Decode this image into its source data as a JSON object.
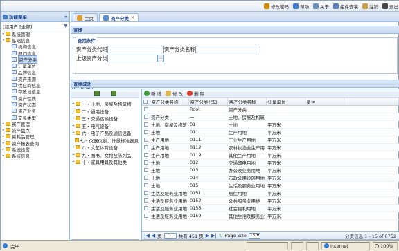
{
  "topbar": {
    "buttons": [
      {
        "label": "修改密码",
        "color": "#d48a00"
      },
      {
        "label": "帮助",
        "color": "#3a7bd5"
      },
      {
        "label": "关于",
        "color": "#6a8bb8"
      },
      {
        "label": "组件安装",
        "color": "#5a7ec0"
      },
      {
        "label": "注销",
        "color": "#c8a040"
      },
      {
        "label": "退出",
        "color": "#444444"
      }
    ]
  },
  "sidebar": {
    "title": "功能菜单",
    "collapse": "«",
    "user": "[超用户 [全部]",
    "tree": [
      {
        "label": "系统管理",
        "type": "folder",
        "toggle": "+",
        "indent": 0
      },
      {
        "label": "基础信息",
        "type": "folder",
        "toggle": "-",
        "indent": 0
      },
      {
        "label": "机构信息",
        "type": "leaf",
        "indent": 1
      },
      {
        "label": "部门信息",
        "type": "leaf",
        "indent": 1
      },
      {
        "label": "资产分类",
        "type": "leaf",
        "indent": 1,
        "selected": true
      },
      {
        "label": "计量单位",
        "type": "leaf",
        "indent": 1
      },
      {
        "label": "品牌信息",
        "type": "leaf",
        "indent": 1
      },
      {
        "label": "资产来源",
        "type": "leaf",
        "indent": 1
      },
      {
        "label": "供应商信息",
        "type": "leaf",
        "indent": 1
      },
      {
        "label": "存放地信息",
        "type": "leaf",
        "indent": 1
      },
      {
        "label": "资产性质",
        "type": "leaf",
        "indent": 1
      },
      {
        "label": "资产状态",
        "type": "leaf",
        "indent": 1
      },
      {
        "label": "资产业务",
        "type": "leaf",
        "indent": 1
      },
      {
        "label": "交易类型",
        "type": "leaf",
        "indent": 1
      },
      {
        "label": "资产管理",
        "type": "folder",
        "toggle": "+",
        "indent": 0
      },
      {
        "label": "资产盘点",
        "type": "folder",
        "toggle": "+",
        "indent": 0
      },
      {
        "label": "易耗品管理",
        "type": "folder",
        "toggle": "+",
        "indent": 0
      },
      {
        "label": "资产报表查询",
        "type": "folder",
        "toggle": "+",
        "indent": 0
      },
      {
        "label": "系统设置",
        "type": "folder",
        "toggle": "+",
        "indent": 0
      },
      {
        "label": "系统信息",
        "type": "folder",
        "toggle": "+",
        "indent": 0
      }
    ]
  },
  "tabs": [
    {
      "label": "主页",
      "active": false,
      "closable": false
    },
    {
      "label": "资产分类",
      "active": true,
      "closable": true
    }
  ],
  "search": {
    "panel_title": "查找",
    "legend": "查找条件",
    "code_label": "资产分类代码",
    "name_label": "资产分类名称",
    "parent_label": "上级资产分类",
    "code_value": "",
    "name_value": "",
    "parent_value": "",
    "parent_browse": "...",
    "button": "查 找"
  },
  "result": {
    "panel_title": "查找成功",
    "categories": [
      {
        "label": "一・土地、房屋及构筑物"
      },
      {
        "label": "二・通用设备"
      },
      {
        "label": "三・交通运输设备"
      },
      {
        "label": "五・电气设备"
      },
      {
        "label": "六・电子产品及通信设备"
      },
      {
        "label": "七・仪器仪表、计量标准器具"
      },
      {
        "label": "八・文艺体育设备"
      },
      {
        "label": "九・图书、文物及陈列品"
      },
      {
        "label": "十・家具用具及其他类"
      }
    ],
    "toolbar": {
      "add": "新 增",
      "edit": "修 改",
      "delete": "删 除"
    },
    "columns": [
      "资产分类名称",
      "资产分类代码",
      "资产分类名称",
      "计量单位",
      "备注"
    ],
    "rows": [
      [
        "",
        "Root",
        "资产分类",
        "",
        ""
      ],
      [
        "资产分类",
        "一",
        "土地、房屋及构筑",
        "",
        ""
      ],
      [
        "土地、房屋及构筑",
        "01",
        "土地",
        "平方米",
        ""
      ],
      [
        "土地",
        "011",
        "生产用地",
        "平方米",
        ""
      ],
      [
        "生产用地",
        "0111",
        "工业生产用地",
        "平方米",
        ""
      ],
      [
        "生产用地",
        "0112",
        "农林牧渔业生产用",
        "平方米",
        ""
      ],
      [
        "生产用地",
        "0119",
        "其他生产用地",
        "平方米",
        ""
      ],
      [
        "土地",
        "012",
        "交通邮电用地",
        "平方米",
        ""
      ],
      [
        "土地",
        "013",
        "办公及业务用地",
        "平方米",
        ""
      ],
      [
        "土地",
        "014",
        "市政公用设施用地",
        "平方米",
        ""
      ],
      [
        "土地",
        "015",
        "生活及服务业用地",
        "平方米",
        ""
      ],
      [
        "生活及服务业用地",
        "0151",
        "居住用地",
        "平方米",
        ""
      ],
      [
        "生活及服务业用地",
        "0152",
        "公共服务业用地",
        "平方米",
        ""
      ],
      [
        "生活及服务业用地",
        "0153",
        "社会福利用地",
        "平方米",
        ""
      ],
      [
        "生活及服务业用地",
        "0159",
        "其他生活及服务业",
        "平方米",
        ""
      ]
    ],
    "pager": {
      "page_label": "页",
      "page": "1",
      "of_label": "共有 451 页",
      "size_label": "Page Size",
      "size": "15",
      "info": "分页信息 1 - 15 of 6752"
    }
  },
  "status": {
    "text": "完毕",
    "zone": "Internet",
    "zoom": "100%"
  }
}
